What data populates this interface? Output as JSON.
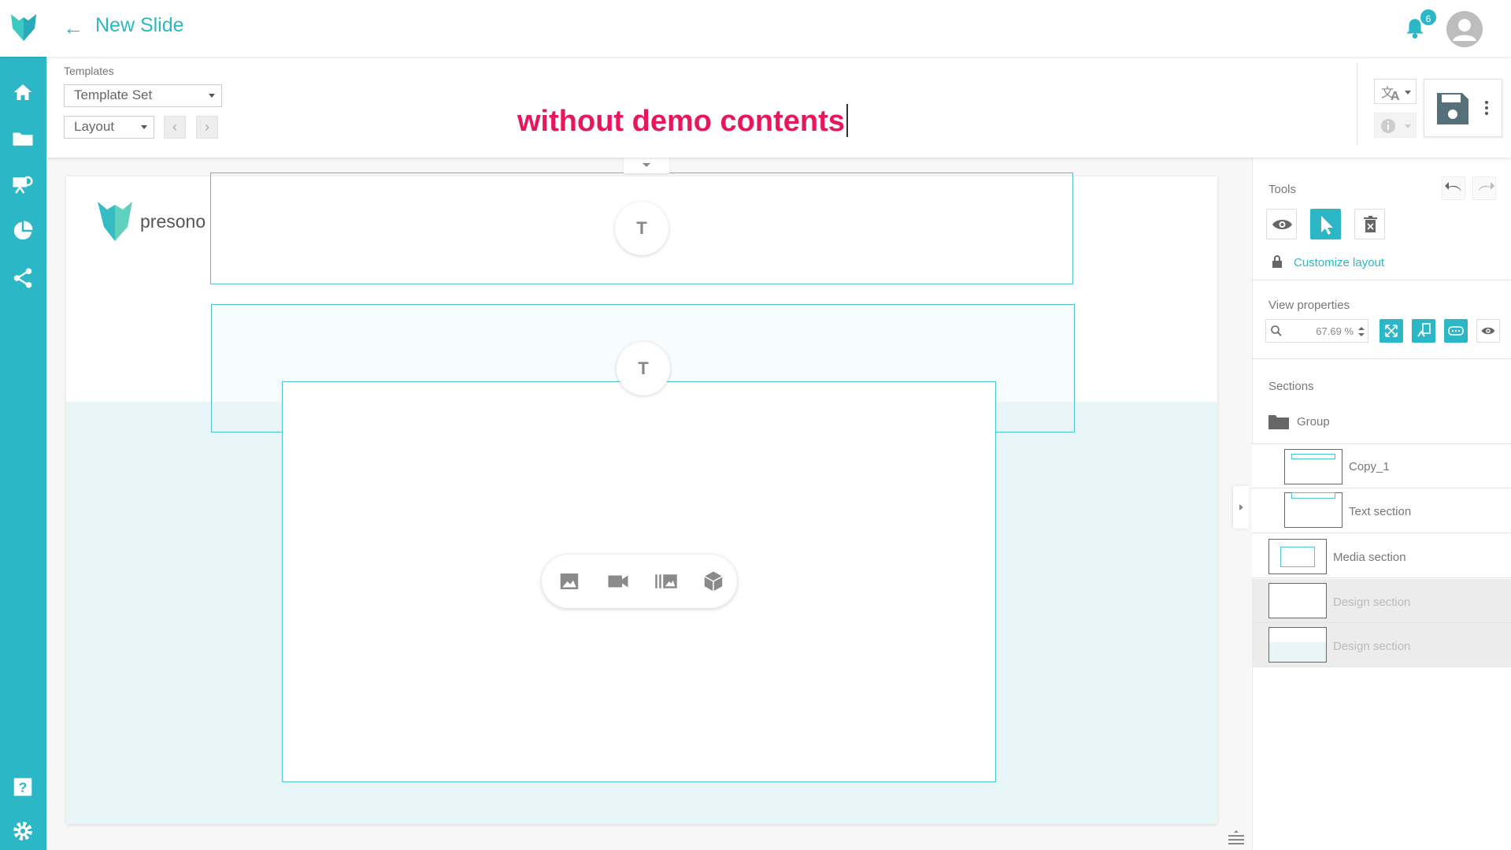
{
  "header": {
    "title": "New Slide",
    "notification_count": "6"
  },
  "sidebar": {
    "items": [
      {
        "icon": "home-icon"
      },
      {
        "icon": "folder-icon"
      },
      {
        "icon": "presentation-icon"
      },
      {
        "icon": "pie-chart-icon"
      },
      {
        "icon": "share-icon"
      },
      {
        "icon": "help-icon"
      },
      {
        "icon": "settings-icon"
      }
    ]
  },
  "toolbar": {
    "templates_label": "Templates",
    "template_set_value": "Template Set",
    "layout_value": "Layout",
    "annotation": "without demo contents"
  },
  "canvas": {
    "logo_text": "presono",
    "text_placeholder": "T"
  },
  "tools_panel": {
    "tools_label": "Tools",
    "customize_label": "Customize layout",
    "view_properties_label": "View properties",
    "zoom_value": "67.69 %",
    "sections_label": "Sections",
    "group_label": "Group",
    "sections": [
      {
        "label": "Copy_1",
        "disabled": false
      },
      {
        "label": "Text section",
        "disabled": false
      },
      {
        "label": "Media section",
        "disabled": false
      },
      {
        "label": "Design section",
        "disabled": true
      },
      {
        "label": "Design section",
        "disabled": true
      }
    ]
  },
  "colors": {
    "accent": "#2bb7c5",
    "annotation": "#e8175d",
    "light_band": "#e8f6f8"
  }
}
